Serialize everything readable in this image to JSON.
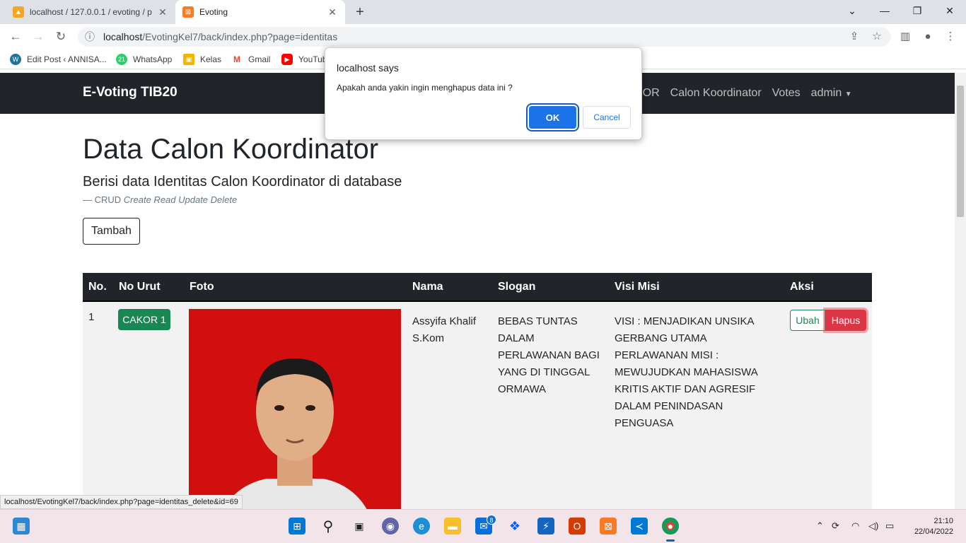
{
  "browser": {
    "tabs": [
      {
        "title": "localhost / 127.0.0.1 / evoting / p",
        "icon": "phpmyadmin-icon"
      },
      {
        "title": "Evoting",
        "icon": "xampp-icon"
      }
    ],
    "address": "localhost/EvotingKel7/back/index.php?page=identitas",
    "address_host": "localhost",
    "address_path": "/EvotingKel7/back/index.php?page=identitas",
    "bookmarks": [
      {
        "label": "Edit Post ‹ ANNISA...",
        "icon": "wordpress-icon"
      },
      {
        "label": "WhatsApp",
        "icon": "whatsapp-icon"
      },
      {
        "label": "Kelas",
        "icon": "classroom-icon"
      },
      {
        "label": "Gmail",
        "icon": "gmail-icon"
      },
      {
        "label": "YouTub",
        "icon": "youtube-icon"
      }
    ],
    "status_url": "localhost/EvotingKel7/back/index.php?page=identitas_delete&id=69"
  },
  "navbar": {
    "brand": "E-Voting TIB20",
    "links": [
      "KOR",
      "Calon Koordinator",
      "Votes",
      "admin"
    ]
  },
  "main": {
    "title": "Data Calon Koordinator",
    "lead": "Berisi data Identitas Calon Koordinator di database",
    "crud_prefix": "—  CRUD",
    "crud_italic": "Create Read Update Delete",
    "add_button": "Tambah"
  },
  "table": {
    "headers": [
      "No.",
      "No Urut",
      "Foto",
      "Nama",
      "Slogan",
      "Visi Misi",
      "Aksi"
    ],
    "rows": [
      {
        "no": "1",
        "no_urut": "CAKOR 1",
        "nama": "Assyifa Khalif S.Kom",
        "slogan": "BEBAS TUNTAS DALAM PERLAWANAN BAGI YANG DI TINGGAL ORMAWA",
        "visi_misi": "VISI : MENJADIKAN UNSIKA GERBANG UTAMA PERLAWANAN MISI : MEWUJUDKAN MAHASISWA KRITIS AKTIF DAN AGRESIF DALAM PENINDASAN PENGUASA",
        "edit_label": "Ubah",
        "delete_label": "Hapus"
      }
    ]
  },
  "dialog": {
    "title": "localhost says",
    "message": "Apakah anda yakin ingin menghapus data ini ?",
    "ok_label": "OK",
    "cancel_label": "Cancel"
  },
  "taskbar": {
    "time": "21:10",
    "date": "22/04/2022",
    "mail_badge": "8"
  },
  "colors": {
    "navbar_bg": "#212529",
    "badge_green": "#198754",
    "delete_red": "#dc3545",
    "photo_bg": "#d10f0f",
    "dialog_ok": "#1a73e8"
  }
}
